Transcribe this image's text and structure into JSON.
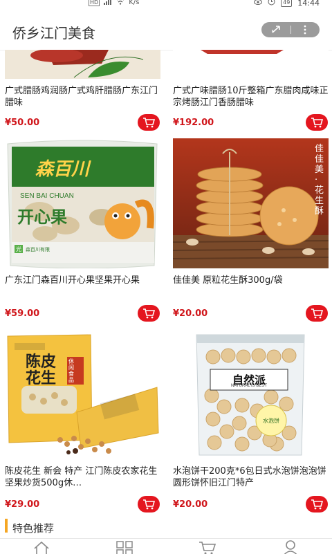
{
  "status_bar": {
    "network_speed": "K/s",
    "battery": "49",
    "time": "14:44"
  },
  "header": {
    "title": "侨乡江门美食"
  },
  "products": [
    {
      "name": "广式腊肠鸡润肠广式鸡肝腊肠广东江门腊味",
      "price": "¥50.00"
    },
    {
      "name": "广式广味腊肠10斤整箱广东腊肉咸味正宗烤肠江门香肠腊味",
      "price": "¥192.00"
    },
    {
      "name": "广东江门森百川开心果坚果开心果",
      "price": "¥59.00",
      "brand": "森百川",
      "brand_pinyin": "SEN BAI CHUAN",
      "product_label": "开心果",
      "badge": "光"
    },
    {
      "name": "佳佳美 原粒花生酥300g/袋",
      "price": "¥20.00",
      "side_text": "佳佳美·花生酥"
    },
    {
      "name": "陈皮花生 新会 特产 江门陈皮农家花生坚果炒货500g休…",
      "price": "¥29.00",
      "bag_text": "陈皮花生",
      "tag": "休闲食品"
    },
    {
      "name": "水泡饼干200克*6包日式水泡饼泡泡饼圆形饼怀旧江门特产",
      "price": "¥20.00",
      "bag_brand": "自然派",
      "bag_sub": "NATURAL IS BEST",
      "sticker": "水泡饼"
    }
  ],
  "section": {
    "title": "特色推荐"
  },
  "colors": {
    "accent": "#e4161f",
    "price": "#d0161b",
    "section_bar": "#f5a623"
  }
}
